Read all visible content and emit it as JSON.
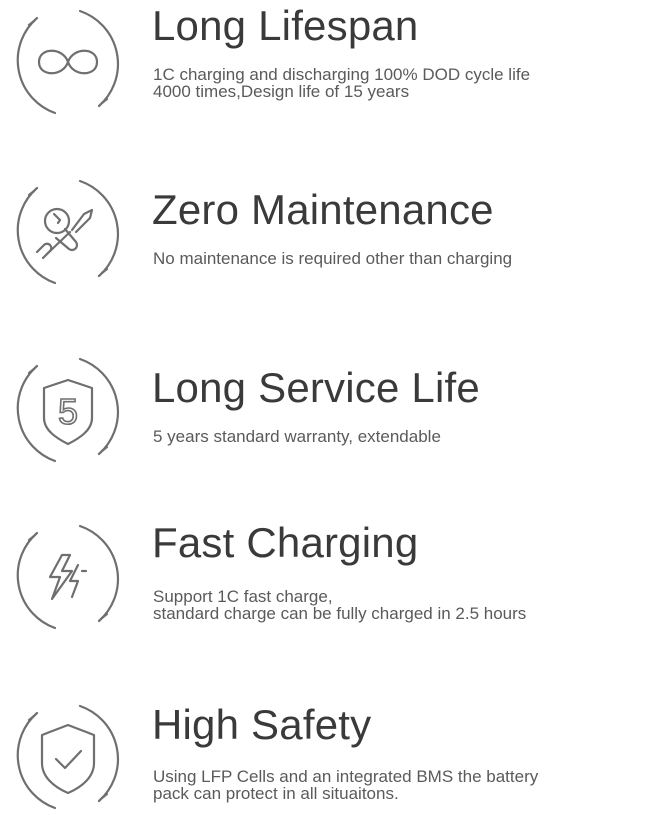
{
  "features": [
    {
      "icon": "infinity-icon",
      "title": "Long Lifespan",
      "desc_lines": [
        "1C charging and discharging 100% DOD cycle life",
        "4000 times,Design life of 15 years"
      ]
    },
    {
      "icon": "wrench-screwdriver-icon",
      "title": "Zero Maintenance",
      "desc_lines": [
        "No maintenance is required other than charging"
      ]
    },
    {
      "icon": "shield-number-five-icon",
      "icon_text": "5",
      "title": "Long Service Life",
      "desc_lines": [
        "5 years standard warranty, extendable"
      ]
    },
    {
      "icon": "lightning-bolt-icon",
      "title": "Fast Charging",
      "desc_lines": [
        "Support 1C fast charge,",
        "standard charge can be fully charged in 2.5 hours"
      ]
    },
    {
      "icon": "shield-check-icon",
      "title": "High Safety",
      "desc_lines": [
        "Using LFP Cells and an integrated BMS the battery",
        "pack can protect in all situaitons."
      ]
    }
  ],
  "colors": {
    "icon_stroke": "#6f6f6f",
    "title": "#3a3a3a",
    "text": "#5a5a5a"
  }
}
